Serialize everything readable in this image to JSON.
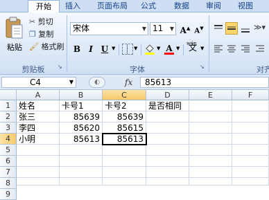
{
  "tabs": [
    "开始",
    "插入",
    "页面布局",
    "公式",
    "数据",
    "审阅",
    "视图"
  ],
  "active_tab": "开始",
  "clipboard": {
    "paste_label": "粘贴",
    "cut_label": "剪切",
    "copy_label": "复制",
    "format_painter_label": "格式刷",
    "group_label": "剪贴板"
  },
  "font": {
    "font_name": "宋体",
    "font_size": "11",
    "bold": "B",
    "italic": "I",
    "underline": "U",
    "grow": "A",
    "shrink": "A",
    "font_color_letter": "A",
    "phonetic": "wén",
    "group_label": "字体"
  },
  "alignment": {
    "group_label": "对齐"
  },
  "formula_bar": {
    "name_box": "C4",
    "fx": "fx",
    "value": "85613"
  },
  "columns": [
    "A",
    "B",
    "C",
    "D",
    "E",
    "F"
  ],
  "rows": [
    "1",
    "2",
    "3",
    "4",
    "5",
    "6",
    "7",
    "8",
    "9"
  ],
  "cells": {
    "header": [
      "姓名",
      "卡号1",
      "卡号2",
      "是否相同"
    ],
    "data": [
      [
        "张三",
        "85639",
        "85639"
      ],
      [
        "李四",
        "85620",
        "85615"
      ],
      [
        "小明",
        "85613",
        "85613"
      ]
    ]
  },
  "colors": {
    "accent": "#15428b",
    "ribbon_bg": "#dbe7f7",
    "grid_line": "#d0d7e5"
  }
}
